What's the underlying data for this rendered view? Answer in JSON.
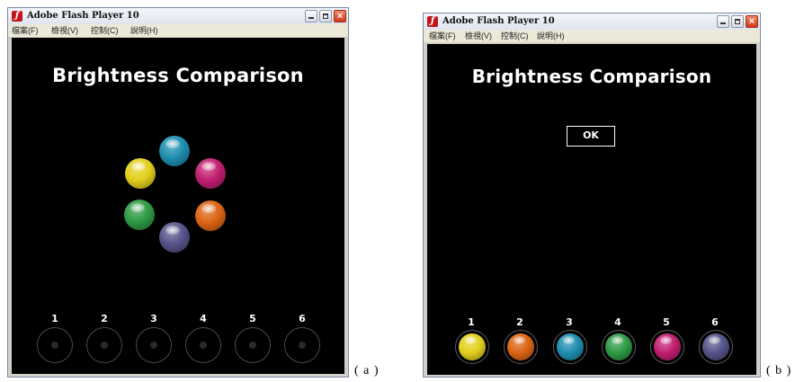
{
  "window_a": {
    "title": "Adobe Flash Player 10",
    "app_icon": "flash-icon",
    "menu": [
      "檔案(F)",
      "檢視(V)",
      "控制(C)",
      "說明(H)"
    ],
    "heading": "Brightness Comparison",
    "slot_numbers": [
      "1",
      "2",
      "3",
      "4",
      "5",
      "6"
    ]
  },
  "window_b": {
    "title": "Adobe Flash Player 10",
    "app_icon": "flash-icon",
    "menu": [
      "檔案(F)",
      "檢視(V)",
      "控制(C)",
      "說明(H)"
    ],
    "heading": "Brightness Comparison",
    "ok_label": "OK",
    "slot_numbers": [
      "1",
      "2",
      "3",
      "4",
      "5",
      "6"
    ]
  },
  "ball_colors": {
    "yellow": "#e2cf1c",
    "teal": "#1f8eb0",
    "magenta": "#c11e70",
    "orange": "#dc6414",
    "purple": "#55538a",
    "green": "#2e9a44"
  },
  "placed_order_b": [
    "yellow",
    "orange",
    "teal",
    "green",
    "magenta",
    "purple"
  ],
  "labels": {
    "a": "( a )",
    "b": "( b )"
  }
}
